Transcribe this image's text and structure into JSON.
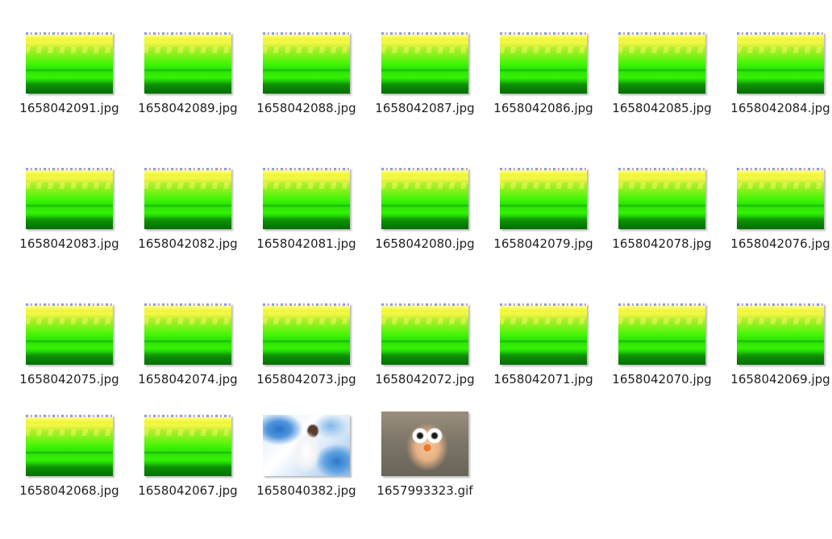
{
  "files": [
    {
      "name": "1658042091.jpg",
      "thumb": "green",
      "col": 0,
      "row": 0
    },
    {
      "name": "1658042089.jpg",
      "thumb": "green",
      "col": 1,
      "row": 0
    },
    {
      "name": "1658042088.jpg",
      "thumb": "green",
      "col": 2,
      "row": 0
    },
    {
      "name": "1658042087.jpg",
      "thumb": "green",
      "col": 3,
      "row": 0
    },
    {
      "name": "1658042086.jpg",
      "thumb": "green",
      "col": 4,
      "row": 0
    },
    {
      "name": "1658042085.jpg",
      "thumb": "green",
      "col": 5,
      "row": 0
    },
    {
      "name": "1658042084.jpg",
      "thumb": "green",
      "col": 6,
      "row": 0
    },
    {
      "name": "1658042083.jpg",
      "thumb": "green",
      "col": 0,
      "row": 1
    },
    {
      "name": "1658042082.jpg",
      "thumb": "green",
      "col": 1,
      "row": 1
    },
    {
      "name": "1658042081.jpg",
      "thumb": "green",
      "col": 2,
      "row": 1
    },
    {
      "name": "1658042080.jpg",
      "thumb": "green",
      "col": 3,
      "row": 1
    },
    {
      "name": "1658042079.jpg",
      "thumb": "green",
      "col": 4,
      "row": 1
    },
    {
      "name": "1658042078.jpg",
      "thumb": "green",
      "col": 5,
      "row": 1
    },
    {
      "name": "1658042076.jpg",
      "thumb": "green",
      "col": 6,
      "row": 1
    },
    {
      "name": "1658042075.jpg",
      "thumb": "green",
      "col": 0,
      "row": 2
    },
    {
      "name": "1658042074.jpg",
      "thumb": "green",
      "col": 1,
      "row": 2
    },
    {
      "name": "1658042073.jpg",
      "thumb": "green",
      "col": 2,
      "row": 2
    },
    {
      "name": "1658042072.jpg",
      "thumb": "green",
      "col": 3,
      "row": 2
    },
    {
      "name": "1658042071.jpg",
      "thumb": "green",
      "col": 4,
      "row": 2
    },
    {
      "name": "1658042070.jpg",
      "thumb": "green",
      "col": 5,
      "row": 2
    },
    {
      "name": "1658042069.jpg",
      "thumb": "green",
      "col": 6,
      "row": 2
    },
    {
      "name": "1658042068.jpg",
      "thumb": "green",
      "col": 0,
      "row": 3
    },
    {
      "name": "1658042067.jpg",
      "thumb": "green",
      "col": 1,
      "row": 3
    },
    {
      "name": "1658040382.jpg",
      "thumb": "anime",
      "col": 2,
      "row": 3
    },
    {
      "name": "1657993323.gif",
      "thumb": "bird",
      "col": 3,
      "row": 3
    }
  ]
}
